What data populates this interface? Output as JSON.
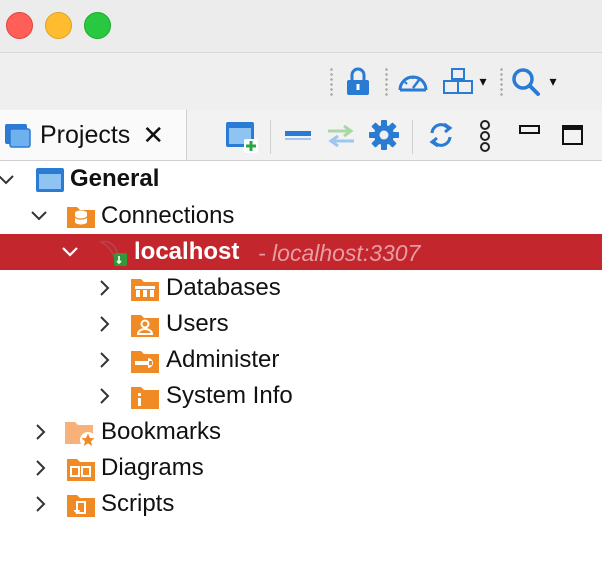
{
  "window": {
    "controls": [
      "close",
      "minimize",
      "zoom"
    ]
  },
  "toolbar": {
    "icons": [
      "lock-icon",
      "speedometer-icon",
      "boxes-icon",
      "search-icon"
    ]
  },
  "panel": {
    "tab_label": "Projects",
    "close_glyph": "✕",
    "actions": [
      "new-folder-icon",
      "collapse-all-icon",
      "link-editor-icon",
      "settings-gear-icon",
      "refresh-icon",
      "more-vertical-icon",
      "minimize-icon",
      "maximize-icon"
    ]
  },
  "tree": {
    "project": "General",
    "connections": "Connections",
    "connection": {
      "name": "localhost",
      "address": "- localhost:3307"
    },
    "children": [
      "Databases",
      "Users",
      "Administer",
      "System Info"
    ],
    "other": [
      "Bookmarks",
      "Diagrams",
      "Scripts"
    ]
  },
  "colors": {
    "selection": "#c4262e",
    "folder_orange": "#f08a24",
    "accent_blue": "#2a7bd3"
  }
}
